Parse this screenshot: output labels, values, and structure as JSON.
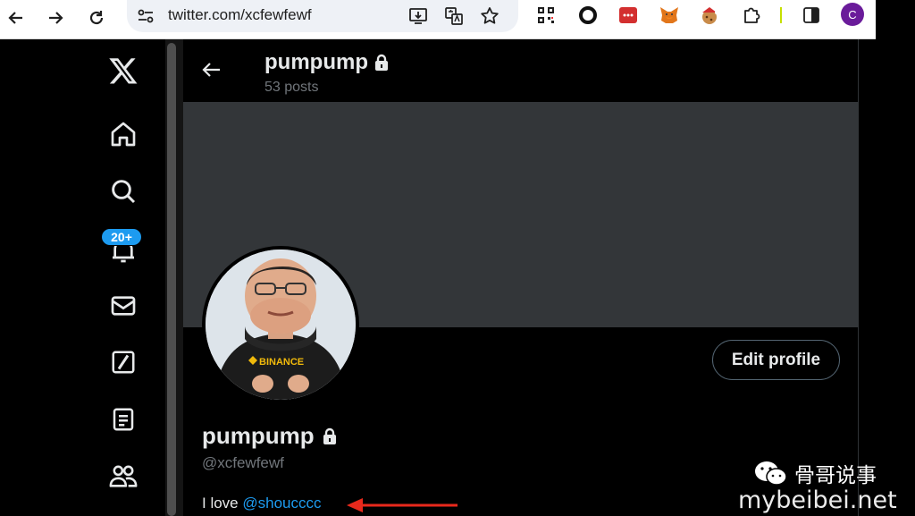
{
  "browser": {
    "url": "twitter.com/xcfewfewf",
    "profile_initial": "C"
  },
  "sidebar": {
    "notification_badge": "20+"
  },
  "header": {
    "name": "pumpump",
    "posts": "53 posts"
  },
  "profile": {
    "display_name": "pumpump",
    "handle": "@xcfewfewf",
    "bio_prefix": "I love ",
    "bio_mention": "@shoucccc",
    "edit_label": "Edit profile",
    "avatar_shirt_text": "BINANCE"
  },
  "watermark": {
    "title": "骨哥说事",
    "site": "mybeibei.net"
  },
  "colors": {
    "accent": "#1d9bf0",
    "banner": "#333639",
    "annotation_arrow": "#e8291c"
  }
}
